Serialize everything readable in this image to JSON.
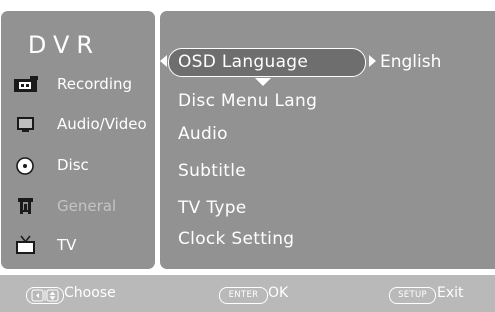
{
  "app": {
    "title": "DVR"
  },
  "sidebar": {
    "items": [
      {
        "label": "Recording",
        "icon": "recorder-icon",
        "state": "normal"
      },
      {
        "label": "Audio/Video",
        "icon": "monitor-icon",
        "state": "normal"
      },
      {
        "label": "Disc",
        "icon": "disc-icon",
        "state": "normal"
      },
      {
        "label": "General",
        "icon": "tools-icon",
        "state": "inactive"
      },
      {
        "label": "TV",
        "icon": "tv-icon",
        "state": "normal"
      }
    ]
  },
  "menu": {
    "items": [
      {
        "label": "OSD Language",
        "value": "English",
        "selected": true
      },
      {
        "label": "Disc Menu Lang"
      },
      {
        "label": "Audio"
      },
      {
        "label": "Subtitle"
      },
      {
        "label": "TV Type"
      },
      {
        "label": "Clock Setting"
      }
    ]
  },
  "footer": {
    "choose_label": "Choose",
    "enter_key": "ENTER",
    "ok_label": "OK",
    "setup_key": "SETUP",
    "exit_label": "Exit"
  },
  "colors": {
    "panel": "#929292",
    "footer": "#b9b9b9",
    "text": "#ffffff",
    "inactive_text": "#c4c4c4"
  }
}
